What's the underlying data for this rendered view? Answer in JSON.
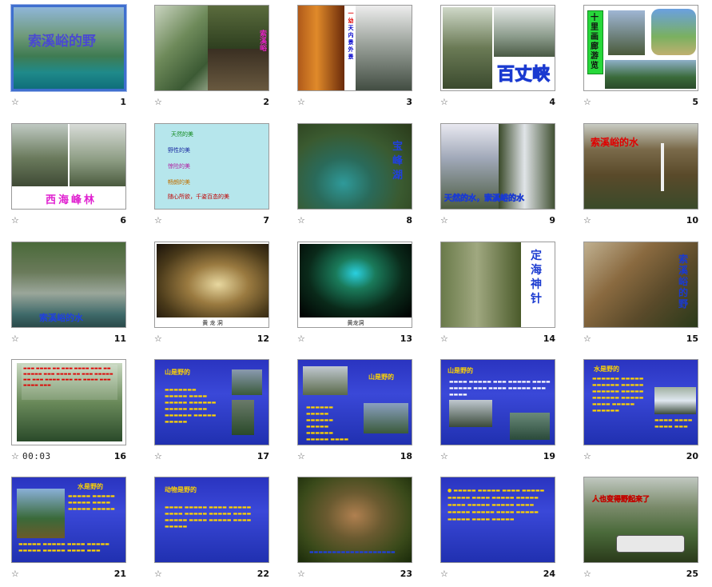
{
  "view": "slide-sorter",
  "star_glyph": "☆",
  "slides": [
    {
      "number": "1",
      "selected": true,
      "overlay": "索溪峪的野"
    },
    {
      "number": "2",
      "overlay": "索溪峪"
    },
    {
      "number": "3",
      "overlay_lines": [
        "一",
        "幼",
        "天",
        "内",
        "景",
        "",
        "外",
        "景"
      ]
    },
    {
      "number": "4",
      "overlay": "百丈峡"
    },
    {
      "number": "5",
      "overlay": "十里画廊游览"
    },
    {
      "number": "6",
      "overlay": "西海峰林"
    },
    {
      "number": "7",
      "items": [
        "天然的美",
        "野性的美",
        "惊险的美",
        "畅朗的美",
        "随心所欲，千姿百态的美"
      ]
    },
    {
      "number": "8",
      "overlay": "宝峰湖"
    },
    {
      "number": "9",
      "overlay": "天然的水，索溪峪的水"
    },
    {
      "number": "10",
      "overlay": "索溪峪的水"
    },
    {
      "number": "11",
      "overlay": "索溪峪的水"
    },
    {
      "number": "12",
      "caption": "黄 龙 洞"
    },
    {
      "number": "13",
      "caption": "黄龙洞"
    },
    {
      "number": "14",
      "overlay": "定海神针"
    },
    {
      "number": "15",
      "overlay": "索溪峪的野"
    },
    {
      "number": "16",
      "timing": "00:03"
    },
    {
      "number": "17",
      "title": "山是野的"
    },
    {
      "number": "18",
      "title": "山是野的"
    },
    {
      "number": "19",
      "title": "山是野的"
    },
    {
      "number": "20",
      "title": "水是野的"
    },
    {
      "number": "21",
      "title": "水是野的"
    },
    {
      "number": "22",
      "title": "动物是野的"
    },
    {
      "number": "23"
    },
    {
      "number": "24"
    },
    {
      "number": "25",
      "overlay": "人也变得野起来了"
    }
  ]
}
